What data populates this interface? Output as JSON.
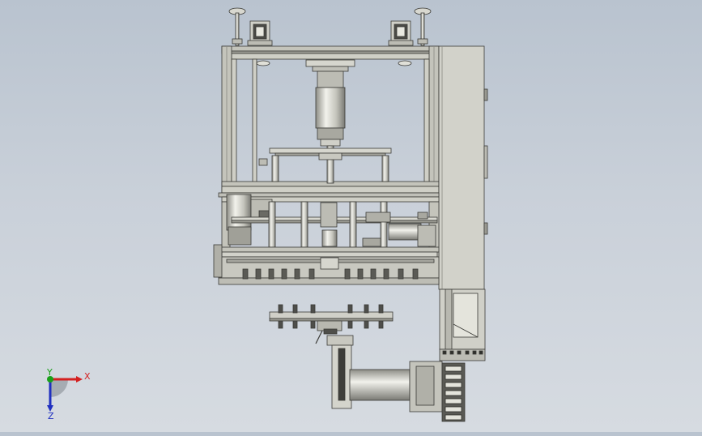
{
  "triad": {
    "x_label": "X",
    "y_label": "Y",
    "z_label": "Z",
    "x_color": "#d42020",
    "y_color": "#1aa01a",
    "z_color": "#2030c0"
  },
  "colors": {
    "frame": "#c8c8bf",
    "frame_dark": "#5a5a55",
    "stroke": "#3a3a36",
    "panel": "#d2d2ca",
    "motor": "#e4e4dc"
  }
}
